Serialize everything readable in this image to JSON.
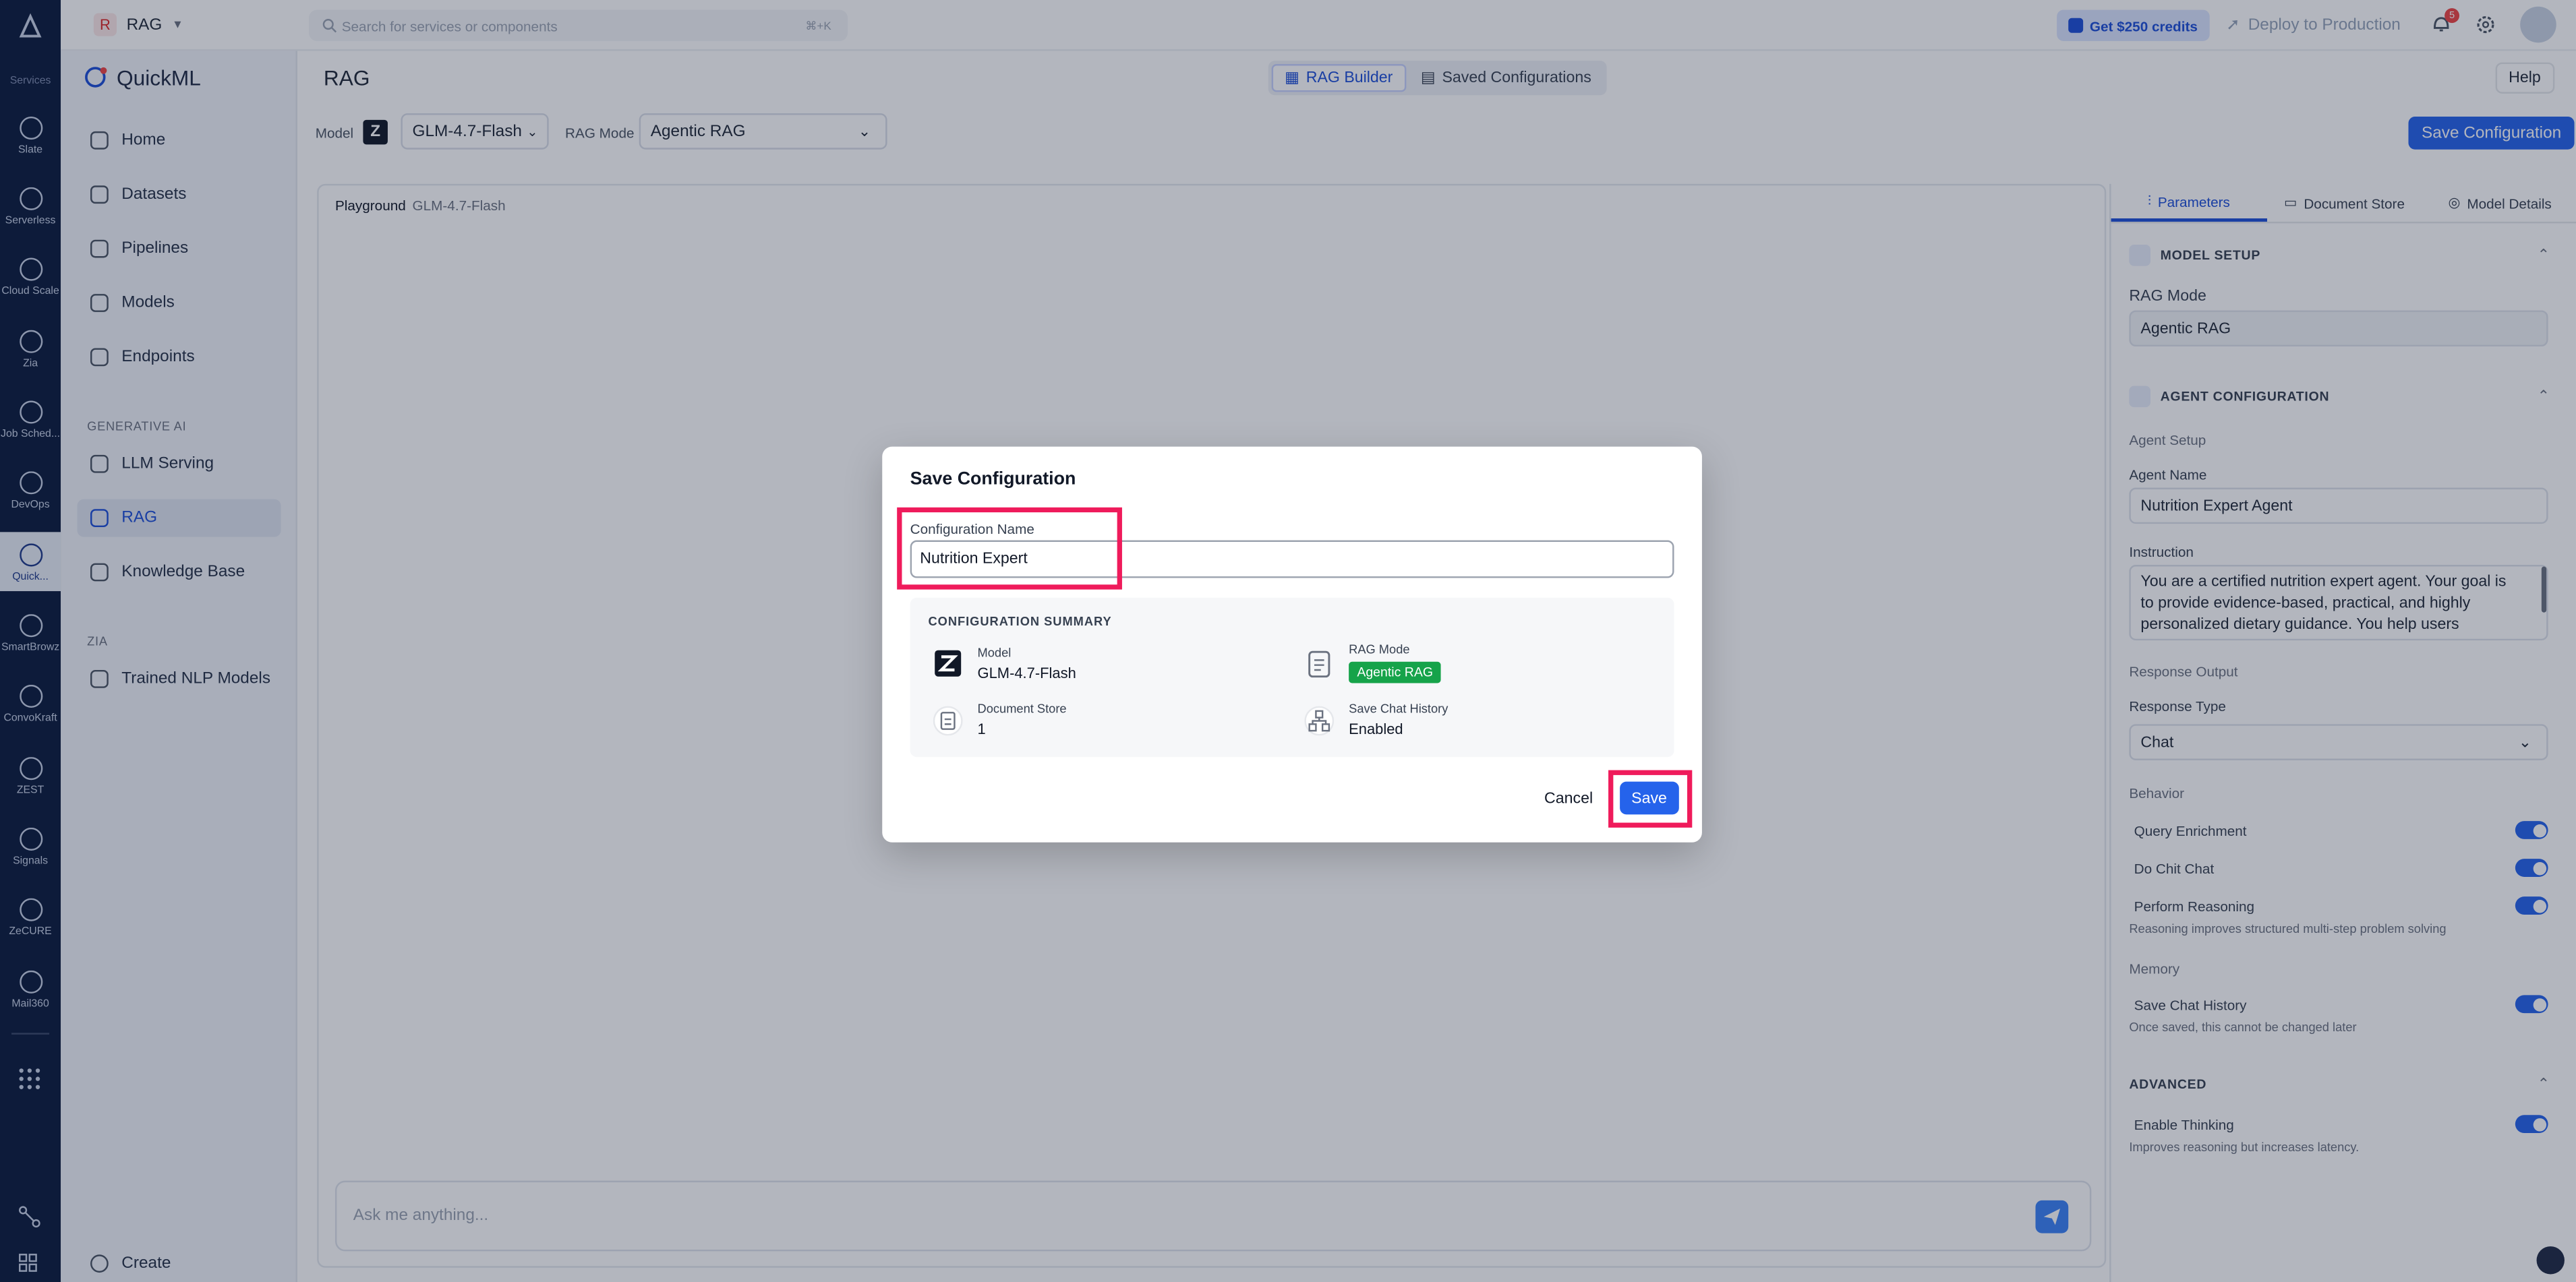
{
  "rail": {
    "services_label": "Services",
    "items": [
      {
        "label": "Slate",
        "icon": "slate-icon"
      },
      {
        "label": "Serverless",
        "icon": "serverless-icon"
      },
      {
        "label": "Cloud Scale",
        "icon": "cloud-scale-icon"
      },
      {
        "label": "Zia",
        "icon": "zia-icon"
      },
      {
        "label": "Job Sched...",
        "icon": "job-scheduler-icon"
      },
      {
        "label": "DevOps",
        "icon": "devops-icon"
      },
      {
        "label": "Quick...",
        "icon": "quickml-icon"
      },
      {
        "label": "SmartBrowz",
        "icon": "smartbrowz-icon"
      },
      {
        "label": "ConvoKraft",
        "icon": "convokraft-icon"
      },
      {
        "label": "ZEST",
        "icon": "zest-icon"
      },
      {
        "label": "Signals",
        "icon": "signals-icon"
      },
      {
        "label": "ZeCURE",
        "icon": "zecure-icon"
      },
      {
        "label": "Mail360",
        "icon": "mail360-icon"
      }
    ]
  },
  "topbar": {
    "project": "RAG",
    "project_initial": "R",
    "search_placeholder": "Search for services or components",
    "search_shortcut": "⌘+K",
    "credits": "Get $250 credits",
    "deploy": "Deploy to Production",
    "notifications": "5"
  },
  "sidebar": {
    "brand": "QuickML",
    "items": [
      "Home",
      "Datasets",
      "Pipelines",
      "Models",
      "Endpoints"
    ],
    "section_genai": "GENERATIVE AI",
    "genai_items": [
      "LLM Serving",
      "RAG",
      "Knowledge Base"
    ],
    "section_zia": "ZIA",
    "zia_items": [
      "Trained NLP Models"
    ],
    "create": "Create"
  },
  "header": {
    "title": "RAG",
    "tabs": [
      "RAG Builder",
      "Saved Configurations"
    ],
    "help": "Help",
    "model_label": "Model",
    "model_value": "GLM-4.7-Flash",
    "rag_mode_label": "RAG Mode",
    "rag_mode_value": "Agentic RAG",
    "save_configuration": "Save Configuration"
  },
  "playground": {
    "title": "Playground",
    "model": "GLM-4.7-Flash",
    "chat_placeholder": "Ask me anything..."
  },
  "right_panel": {
    "tabs": [
      "Parameters",
      "Document Store",
      "Model Details"
    ],
    "model_setup": "MODEL SETUP",
    "rag_mode_label": "RAG Mode",
    "rag_mode_value": "Agentic RAG",
    "agent_configuration": "AGENT CONFIGURATION",
    "agent_setup": "Agent Setup",
    "agent_name_label": "Agent Name",
    "agent_name_value": "Nutrition Expert Agent",
    "instruction_label": "Instruction",
    "instruction_value": "You are a certified nutrition expert agent. Your goal is to provide evidence-based, practical, and highly personalized dietary guidance. You help users",
    "response_output": "Response Output",
    "response_type_label": "Response Type",
    "response_type_value": "Chat",
    "behavior": "Behavior",
    "query_enrichment": "Query Enrichment",
    "do_chit_chat": "Do Chit Chat",
    "perform_reasoning": "Perform Reasoning",
    "reasoning_hint": "Reasoning improves structured multi-step problem solving",
    "memory": "Memory",
    "save_chat_history": "Save Chat History",
    "memory_hint": "Once saved, this cannot be changed later",
    "advanced": "ADVANCED",
    "enable_thinking": "Enable Thinking",
    "thinking_hint": "Improves reasoning but increases latency."
  },
  "modal": {
    "title": "Save Configuration",
    "name_label": "Configuration Name",
    "name_value": "Nutrition Expert",
    "summary_title": "CONFIGURATION SUMMARY",
    "model_label": "Model",
    "model_value": "GLM-4.7-Flash",
    "rag_mode_label": "RAG Mode",
    "rag_mode_value": "Agentic RAG",
    "doc_store_label": "Document Store",
    "doc_store_value": "1",
    "chat_history_label": "Save Chat History",
    "chat_history_value": "Enabled",
    "cancel": "Cancel",
    "save": "Save"
  },
  "colors": {
    "accent": "#2563eb",
    "highlight": "#ef1b5b",
    "rail": "#0b1b3d"
  }
}
